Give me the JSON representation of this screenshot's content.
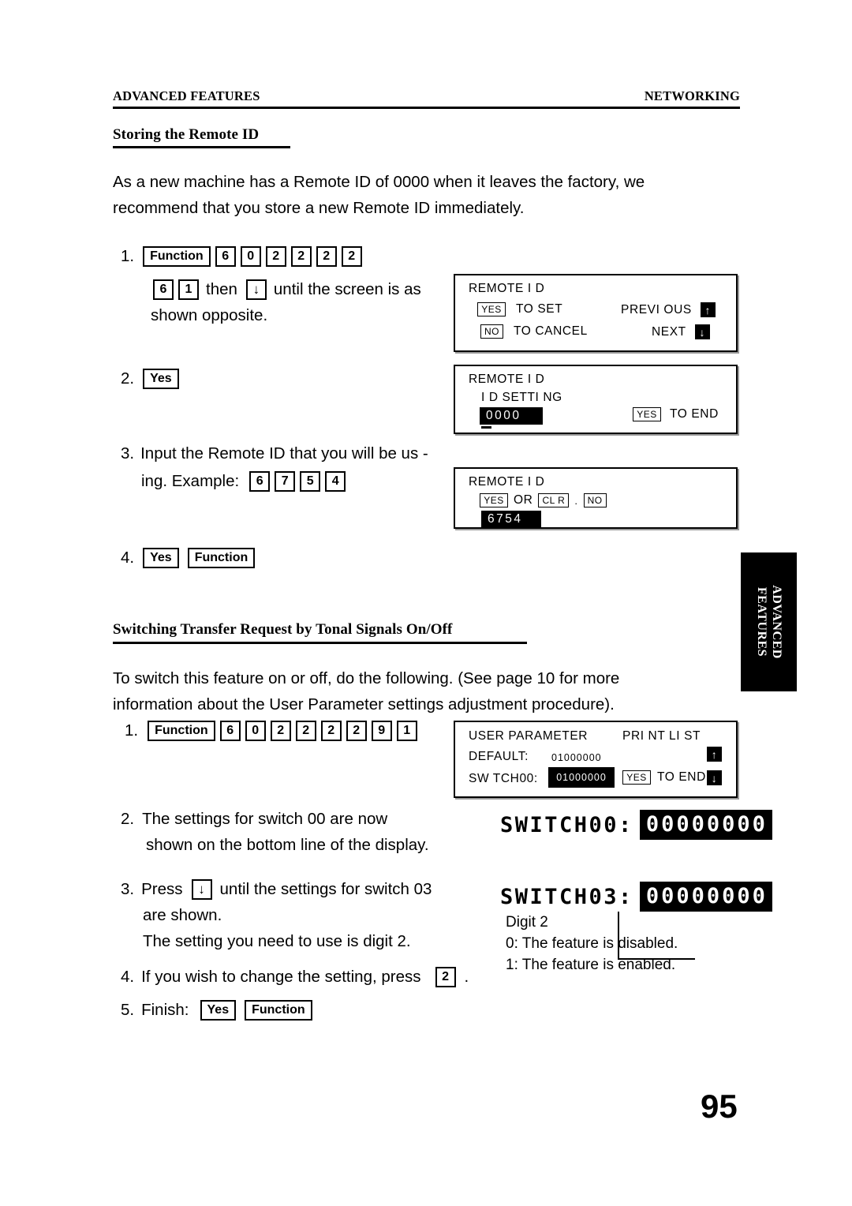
{
  "header": {
    "left": "ADVANCED FEATURES",
    "right": "NETWORKING"
  },
  "section1": {
    "heading": "Storing the Remote ID",
    "intro_line1": "As a new machine has a Remote ID of 0000 when it leaves the factory, we",
    "intro_line2": "recommend that you store a new Remote ID immediately.",
    "step1": {
      "number": "1.",
      "keys": [
        "Function",
        "6",
        "0",
        "2",
        "2",
        "2",
        "2"
      ],
      "keys2": [
        "6",
        "1"
      ],
      "then_label": "then",
      "arrow_key": "↓",
      "tail_text": "until the screen is as",
      "line2_text": "shown opposite."
    },
    "step2": {
      "number": "2.",
      "key": "Yes"
    },
    "step3": {
      "number": "3.",
      "text_line1": "Input the Remote ID that you will be us -",
      "text_line2": "ing. Example:",
      "keys": [
        "6",
        "7",
        "5",
        "4"
      ]
    },
    "step4": {
      "number": "4.",
      "keys": [
        "Yes",
        "Function"
      ]
    }
  },
  "lcd1": {
    "title": "REMOTE I D",
    "row1_key": "YES",
    "row1_label": "TO SET",
    "row1_right_label": "PREVI OUS",
    "row1_arrow": "↑",
    "row2_key": "NO",
    "row2_label": "TO CANCEL",
    "row2_right_label": "NEXT",
    "row2_arrow": "↓"
  },
  "lcd2": {
    "title": "REMOTE I D",
    "subtitle": "I D SETTI NG",
    "value": "0000",
    "right_key": "YES",
    "right_label": "TO END"
  },
  "lcd3": {
    "title": "REMOTE I D",
    "key_yes": "YES",
    "or_label": "OR",
    "key_clr": "CL R",
    "dot": ".",
    "key_no": "NO",
    "value": "6754"
  },
  "section2": {
    "heading": "Switching Transfer Request by Tonal Signals On/Off",
    "intro_line1": "To switch this feature on or off, do the following. (See page   10 for more",
    "intro_line2": "information about the User Parameter settings adjustment procedure).",
    "step1": {
      "number": "1.",
      "keys": [
        "Function",
        "6",
        "0",
        "2",
        "2",
        "2",
        "2",
        "9",
        "1"
      ]
    },
    "step2": {
      "number": "2.",
      "text_line1": "The settings for switch 00 are now",
      "text_line2": "shown on the bottom line of the display."
    },
    "step3": {
      "number": "3.",
      "press_label": "Press",
      "arrow_key": "↓",
      "tail_text": "until the settings for switch 03",
      "text_line2": "are shown.",
      "text_line3": "The setting you need to use is digit 2."
    },
    "step4": {
      "number": "4.",
      "text": "If you wish to change the setting, press",
      "key": "2",
      "period": "."
    },
    "step5": {
      "number": "5.",
      "label": "Finish:",
      "keys": [
        "Yes",
        "Function"
      ]
    }
  },
  "lcd4": {
    "title": "USER PARAMETER",
    "title_right": "PRI NT LI ST",
    "row1_label": "DEFAULT:",
    "row1_value": "01000000",
    "row1_arrow": "↑",
    "row2_label": "SW TCH00:",
    "row2_value": "01000000",
    "row2_key": "YES",
    "row2_key_label": "TO END",
    "row2_arrow": "↓"
  },
  "bigdisp1": {
    "label": "SWITCH00:",
    "value": "00000000"
  },
  "bigdisp2": {
    "label": "SWITCH03:",
    "value": "00000000"
  },
  "annotation": {
    "line1": "Digit 2",
    "line2": "0: The feature is disabled.",
    "line3": "1: The feature is enabled."
  },
  "side_tab": {
    "line1": "ADVANCED",
    "line2": "FEATURES"
  },
  "page_number": "95"
}
